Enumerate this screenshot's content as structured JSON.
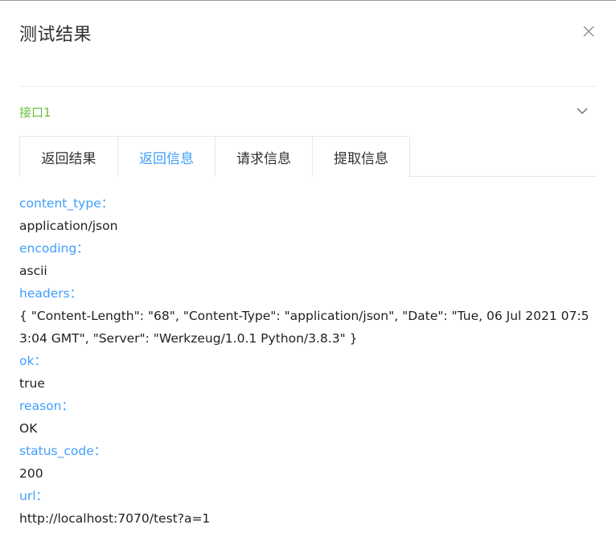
{
  "dialog": {
    "title": "测试结果",
    "close_icon": "close-icon"
  },
  "collapse": {
    "title": "接口1",
    "expanded": true,
    "chevron_icon": "chevron-down-icon"
  },
  "tabs": [
    {
      "label": "返回结果",
      "active": false
    },
    {
      "label": "返回信息",
      "active": true
    },
    {
      "label": "请求信息",
      "active": false
    },
    {
      "label": "提取信息",
      "active": false
    }
  ],
  "info": [
    {
      "key": "content_type：",
      "value": "application/json"
    },
    {
      "key": "encoding：",
      "value": "ascii"
    },
    {
      "key": "headers：",
      "value": "{ \"Content-Length\": \"68\", \"Content-Type\": \"application/json\", \"Date\": \"Tue, 06 Jul 2021 07:53:04 GMT\", \"Server\": \"Werkzeug/1.0.1 Python/3.8.3\" }"
    },
    {
      "key": "ok：",
      "value": "true"
    },
    {
      "key": "reason：",
      "value": "OK"
    },
    {
      "key": "status_code：",
      "value": "200"
    },
    {
      "key": "url：",
      "value": "http://localhost:7070/test?a=1"
    }
  ],
  "colors": {
    "accent": "#409eff",
    "success": "#67c23a",
    "text": "#303133",
    "border": "#e4e7ed"
  }
}
